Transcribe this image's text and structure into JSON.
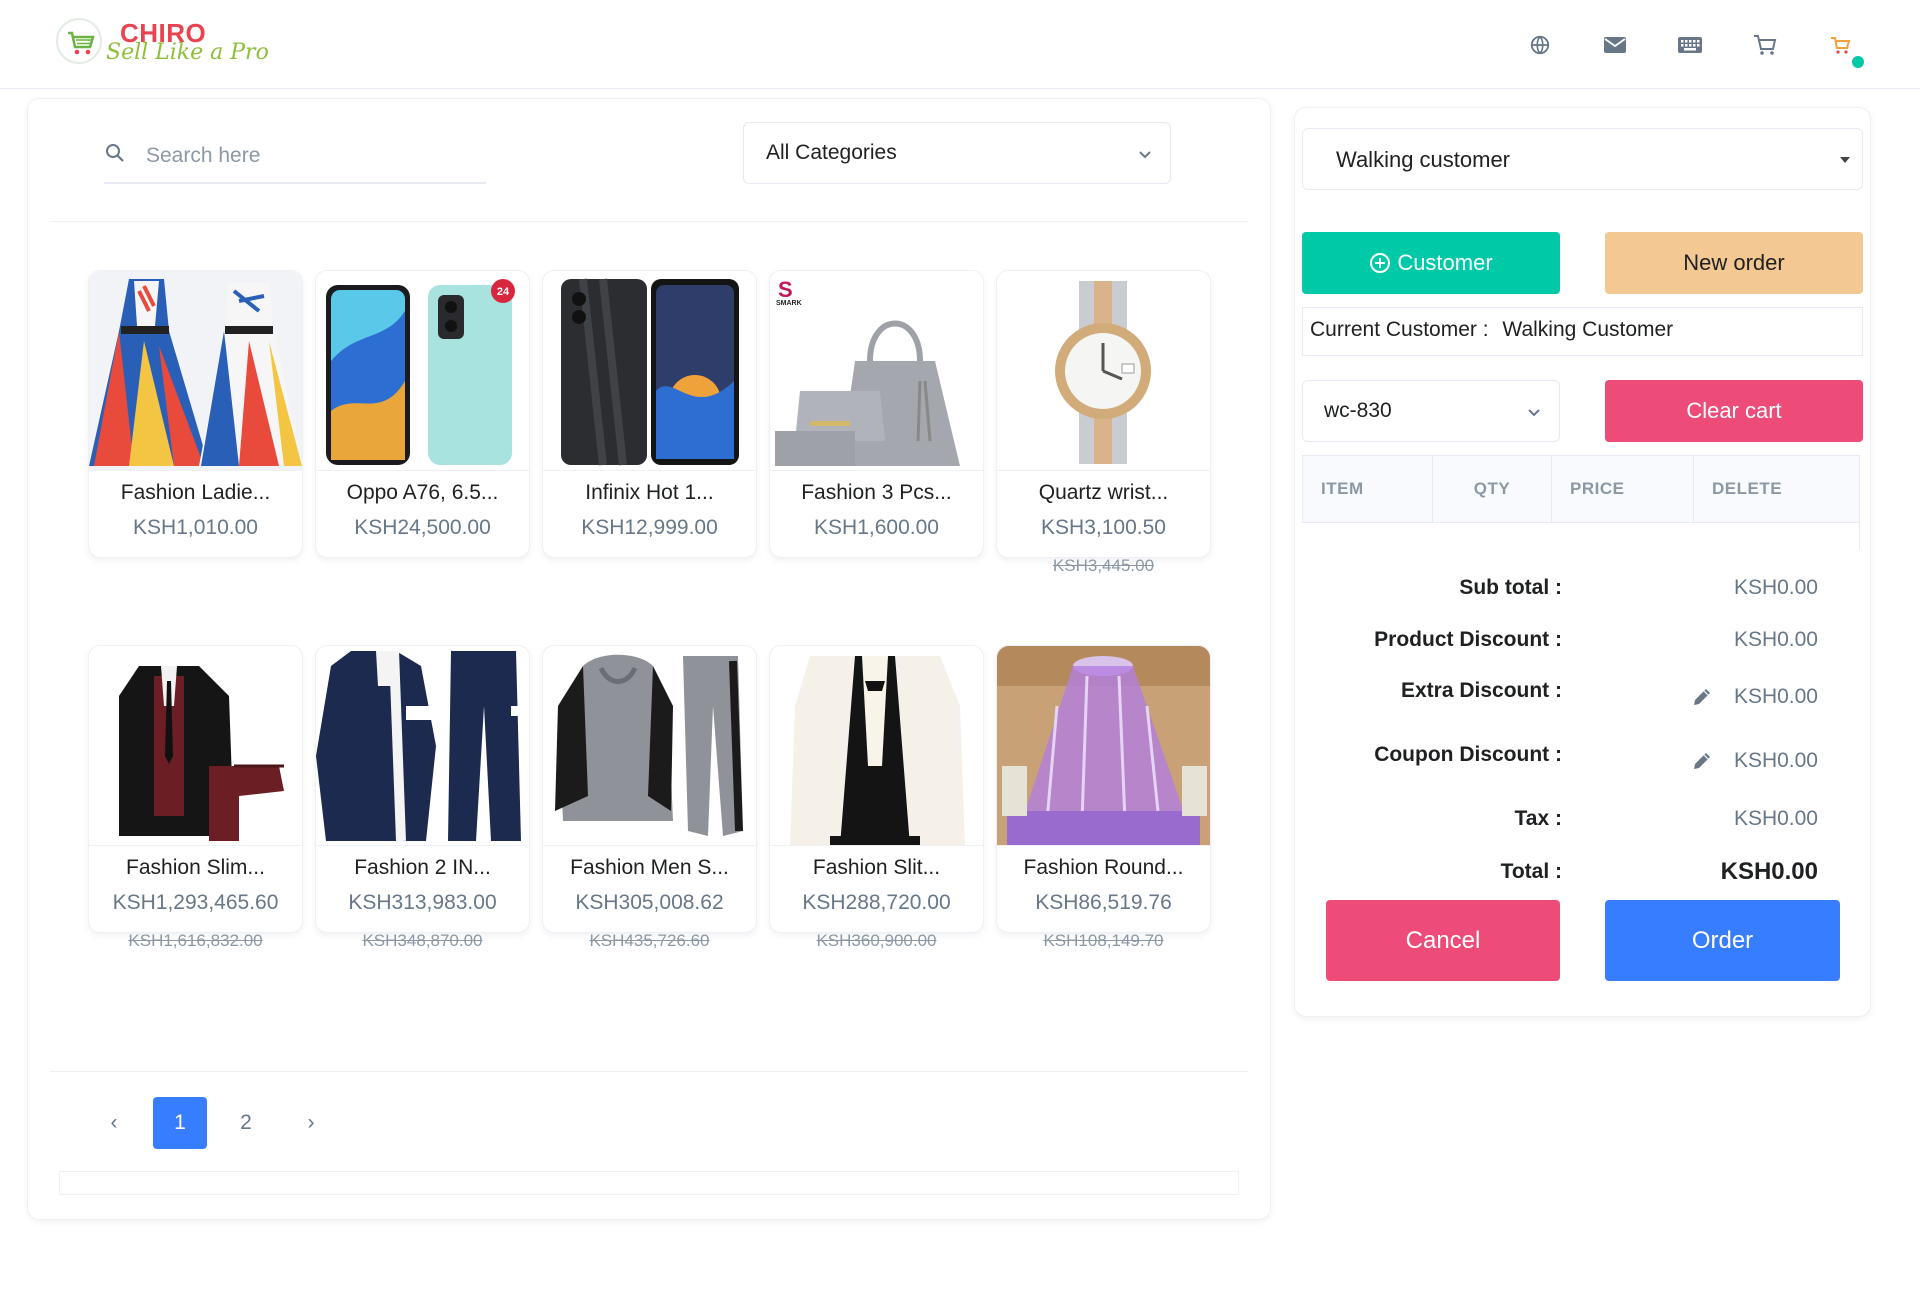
{
  "header": {
    "brand": "CHIRO",
    "tagline": "Sell Like a Pro",
    "icons": [
      "globe-icon",
      "mail-icon",
      "keyboard-icon",
      "cart-icon",
      "profile-icon"
    ],
    "status_color": "#00c9a7"
  },
  "search": {
    "placeholder": "Search here"
  },
  "category_filter": {
    "selected": "All Categories"
  },
  "products": [
    {
      "name": "Fashion Ladie...",
      "price": "KSH1,010.00",
      "old_price": ""
    },
    {
      "name": "Oppo A76, 6.5...",
      "price": "KSH24,500.00",
      "old_price": ""
    },
    {
      "name": "Infinix Hot 1...",
      "price": "KSH12,999.00",
      "old_price": ""
    },
    {
      "name": "Fashion 3 Pcs...",
      "price": "KSH1,600.00",
      "old_price": ""
    },
    {
      "name": "Quartz wrist...",
      "price": "KSH3,100.50",
      "old_price": "KSH3,445.00"
    },
    {
      "name": "Fashion Slim...",
      "price": "KSH1,293,465.60",
      "old_price": "KSH1,616,832.00"
    },
    {
      "name": "Fashion 2 IN...",
      "price": "KSH313,983.00",
      "old_price": "KSH348,870.00"
    },
    {
      "name": "Fashion Men S...",
      "price": "KSH305,008.62",
      "old_price": "KSH435,726.60"
    },
    {
      "name": "Fashion Slit...",
      "price": "KSH288,720.00",
      "old_price": "KSH360,900.00"
    },
    {
      "name": "Fashion Round...",
      "price": "KSH86,519.76",
      "old_price": "KSH108,149.70"
    }
  ],
  "pagination": {
    "prev": "‹",
    "pages": [
      "1",
      "2"
    ],
    "current": "1",
    "next": "›"
  },
  "cart": {
    "customer_select": "Walking customer",
    "add_customer_label": "Customer",
    "new_order_label": "New order",
    "current_customer_label": "Current Customer :",
    "current_customer_value": "Walking Customer",
    "order_id": "wc-830",
    "clear_cart_label": "Clear cart",
    "columns": [
      "ITEM",
      "QTY",
      "PRICE",
      "DELETE"
    ],
    "summary": {
      "subtotal_label": "Sub total :",
      "subtotal": "KSH0.00",
      "product_discount_label": "Product Discount :",
      "product_discount": "KSH0.00",
      "extra_discount_label": "Extra Discount :",
      "extra_discount": "KSH0.00",
      "coupon_discount_label": "Coupon Discount :",
      "coupon_discount": "KSH0.00",
      "tax_label": "Tax :",
      "tax": "KSH0.00",
      "total_label": "Total :",
      "total": "KSH0.00"
    },
    "cancel_label": "Cancel",
    "order_label": "Order"
  },
  "colors": {
    "primary": "#377dff",
    "teal": "#00c9a7",
    "danger": "#ed4c78",
    "peach": "#f3c892",
    "brand_red": "#e8434f",
    "brand_green": "#8fbf3a"
  }
}
